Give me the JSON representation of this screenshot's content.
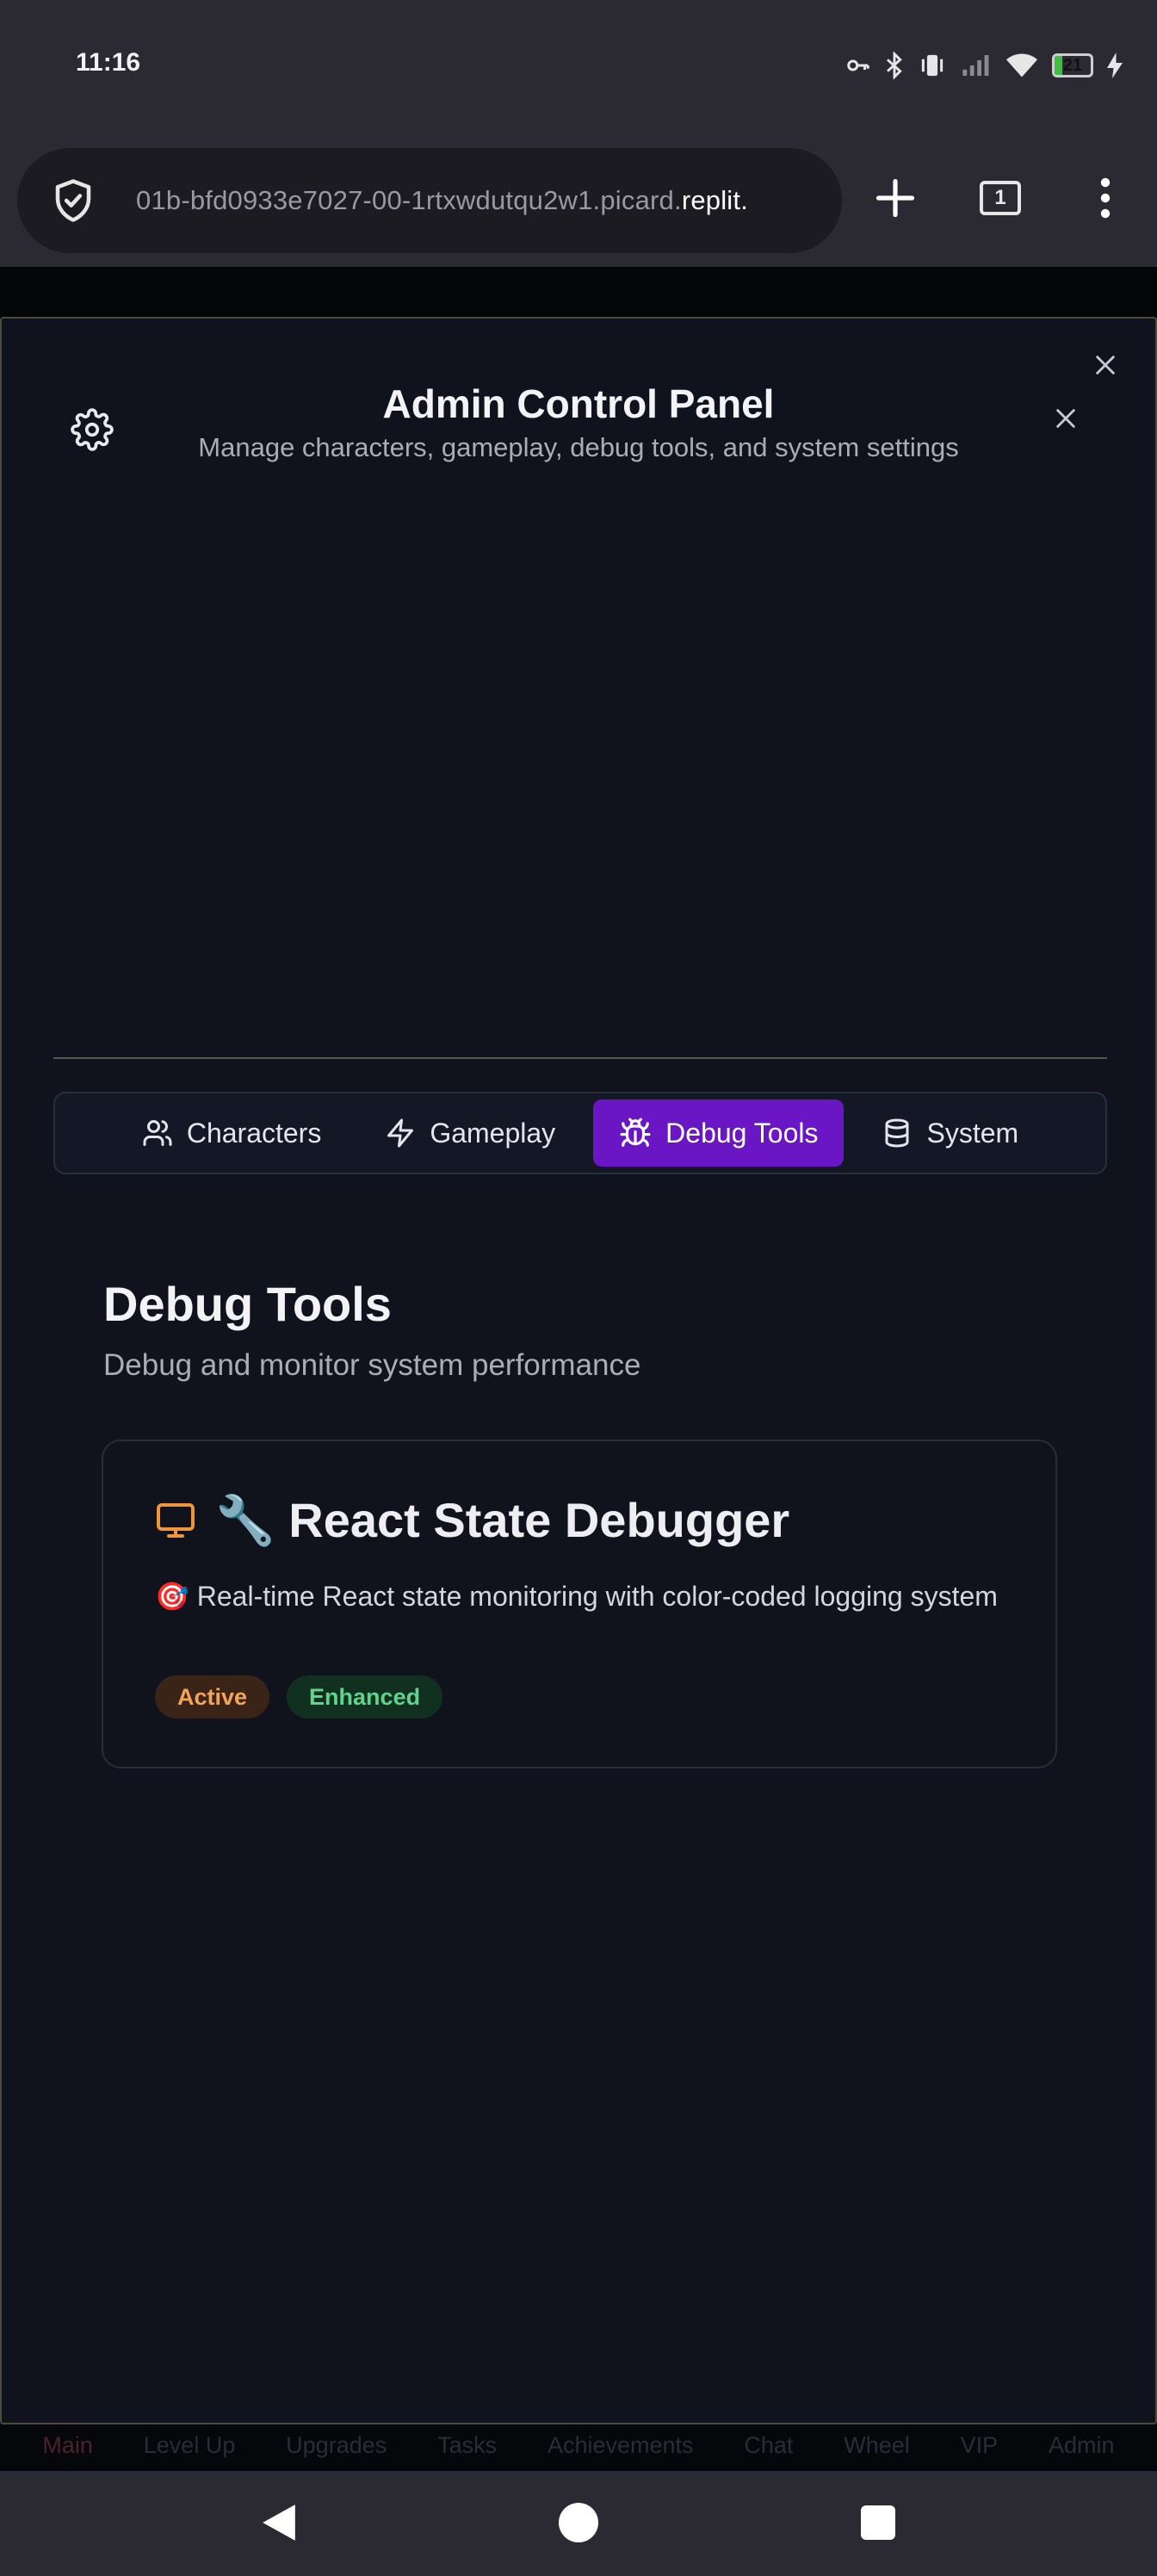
{
  "status_bar": {
    "time": "11:16",
    "battery_percent": "21",
    "icons": [
      "key-icon",
      "bluetooth-icon",
      "vibrate-icon",
      "signal-icon",
      "wifi-icon",
      "battery-icon",
      "charging-icon"
    ]
  },
  "browser": {
    "url_start": "01b-bfd0933e7027-00-1rtxwdutqu2w1.picard.",
    "url_end": "replit.",
    "tab_count": "1"
  },
  "background_nav": {
    "items": [
      "Main",
      "Level Up",
      "Upgrades",
      "Tasks",
      "Achievements",
      "Chat",
      "Wheel",
      "VIP",
      "Admin"
    ]
  },
  "modal": {
    "title": "Admin Control Panel",
    "subtitle": "Manage characters, gameplay, debug tools, and system settings",
    "tabs": [
      {
        "label": "Characters",
        "icon": "users-icon",
        "active": false
      },
      {
        "label": "Gameplay",
        "icon": "zap-icon",
        "active": false
      },
      {
        "label": "Debug Tools",
        "icon": "bug-icon",
        "active": true
      },
      {
        "label": "System",
        "icon": "database-icon",
        "active": false
      }
    ],
    "section": {
      "title": "Debug Tools",
      "subtitle": "Debug and monitor system performance"
    },
    "card": {
      "title": "🔧 React State Debugger",
      "description": "🎯 Real-time React state monitoring with color-coded logging system",
      "badges": [
        "Active",
        "Enhanced"
      ]
    }
  },
  "colors": {
    "accent": "#6b16c4",
    "active_badge": "#f2a55a",
    "enhanced_badge": "#5fd48a",
    "monitor_icon": "#f0963a"
  }
}
